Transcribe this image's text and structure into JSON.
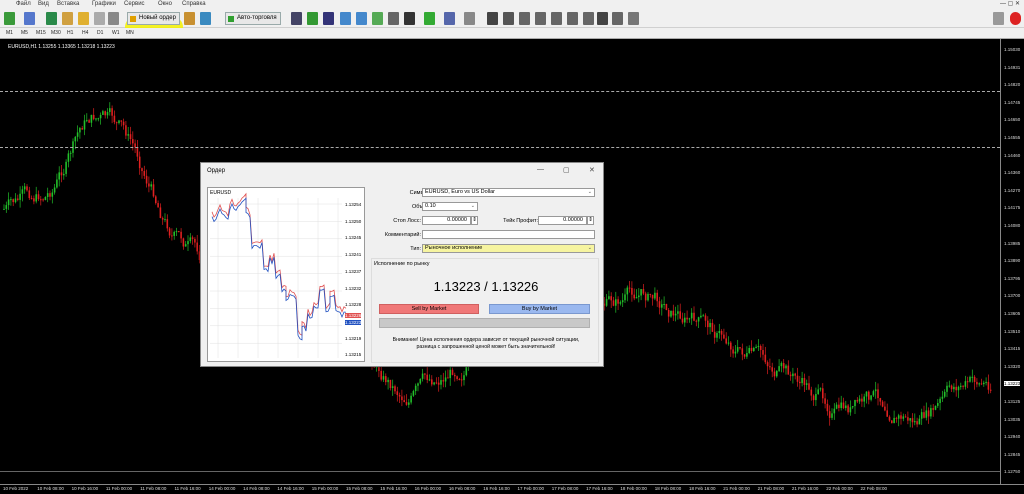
{
  "menu": [
    "Файл",
    "Вид",
    "Вставка",
    "Графики",
    "Сервис",
    "Окно",
    "Справка"
  ],
  "toolbar": {
    "new_order": "Новый ордер",
    "auto_trading": "Авто-торговля"
  },
  "timeframes": [
    "M1",
    "M5",
    "M15",
    "M30",
    "H1",
    "H4",
    "D1",
    "W1",
    "MN"
  ],
  "chart": {
    "symbol_line": "EURUSD,H1  1.13255 1.13365 1.13218 1.13223",
    "price_axis": [
      "1.15030",
      "1.14931",
      "1.14820",
      "1.14745",
      "1.14650",
      "1.14555",
      "1.14460",
      "1.14360",
      "1.14270",
      "1.14175",
      "1.14080",
      "1.13985",
      "1.13890",
      "1.13795",
      "1.13700",
      "1.13605",
      "1.13510",
      "1.13415",
      "1.13320",
      "1.13223",
      "1.13125",
      "1.13035",
      "1.12940",
      "1.12845",
      "1.12750"
    ],
    "time_axis": [
      "10 Feb 2022",
      "10 Feb 08:00",
      "10 Feb 16:00",
      "11 Feb 00:00",
      "11 Feb 08:00",
      "11 Feb 16:00",
      "14 Feb 00:00",
      "14 Feb 08:00",
      "14 Feb 16:00",
      "15 Feb 00:00",
      "15 Feb 08:00",
      "15 Feb 16:00",
      "16 Feb 00:00",
      "16 Feb 08:00",
      "16 Feb 16:00",
      "17 Feb 00:00",
      "17 Feb 08:00",
      "17 Feb 16:00",
      "18 Feb 00:00",
      "18 Feb 08:00",
      "18 Feb 16:00",
      "21 Feb 00:00",
      "21 Feb 08:00",
      "21 Feb 16:00",
      "22 Feb 00:00",
      "22 Feb 08:00"
    ],
    "colors": {
      "bull": "#22c02a",
      "bear": "#e02020",
      "background": "#000000",
      "highlight": "#f4f200"
    }
  },
  "dialog": {
    "title": "Ордер",
    "mini_chart": {
      "label": "EURUSD",
      "prices": [
        "1.13254",
        "1.13250",
        "1.13245",
        "1.13241",
        "1.13237",
        "1.13232",
        "1.13228",
        "1.13223",
        "1.13219",
        "1.13215"
      ],
      "bid_tag": "1.13226",
      "ask_tag": "1.13223"
    },
    "symbol_label": "Символ:",
    "symbol_value": "EURUSD, Euro vs US Dollar",
    "volume_label": "Объем:",
    "volume_value": "0.10",
    "sl_label": "Стоп Лосс:",
    "sl_value": "0.00000",
    "tp_label": "Тейк Профит:",
    "tp_value": "0.00000",
    "comment_label": "Комментарий:",
    "comment_value": "",
    "type_label": "Тип:",
    "type_value": "Рыночное исполнение",
    "exec_header": "Исполнение по рынку",
    "quote": "1.13223 / 1.13226",
    "sell_button": "Sell by Market",
    "buy_button": "Buy by Market",
    "warning_line1": "Внимание! Цена исполнения ордера зависит от текущей рыночной ситуации,",
    "warning_line2": "разница с запрошенной ценой может быть значительной!"
  }
}
